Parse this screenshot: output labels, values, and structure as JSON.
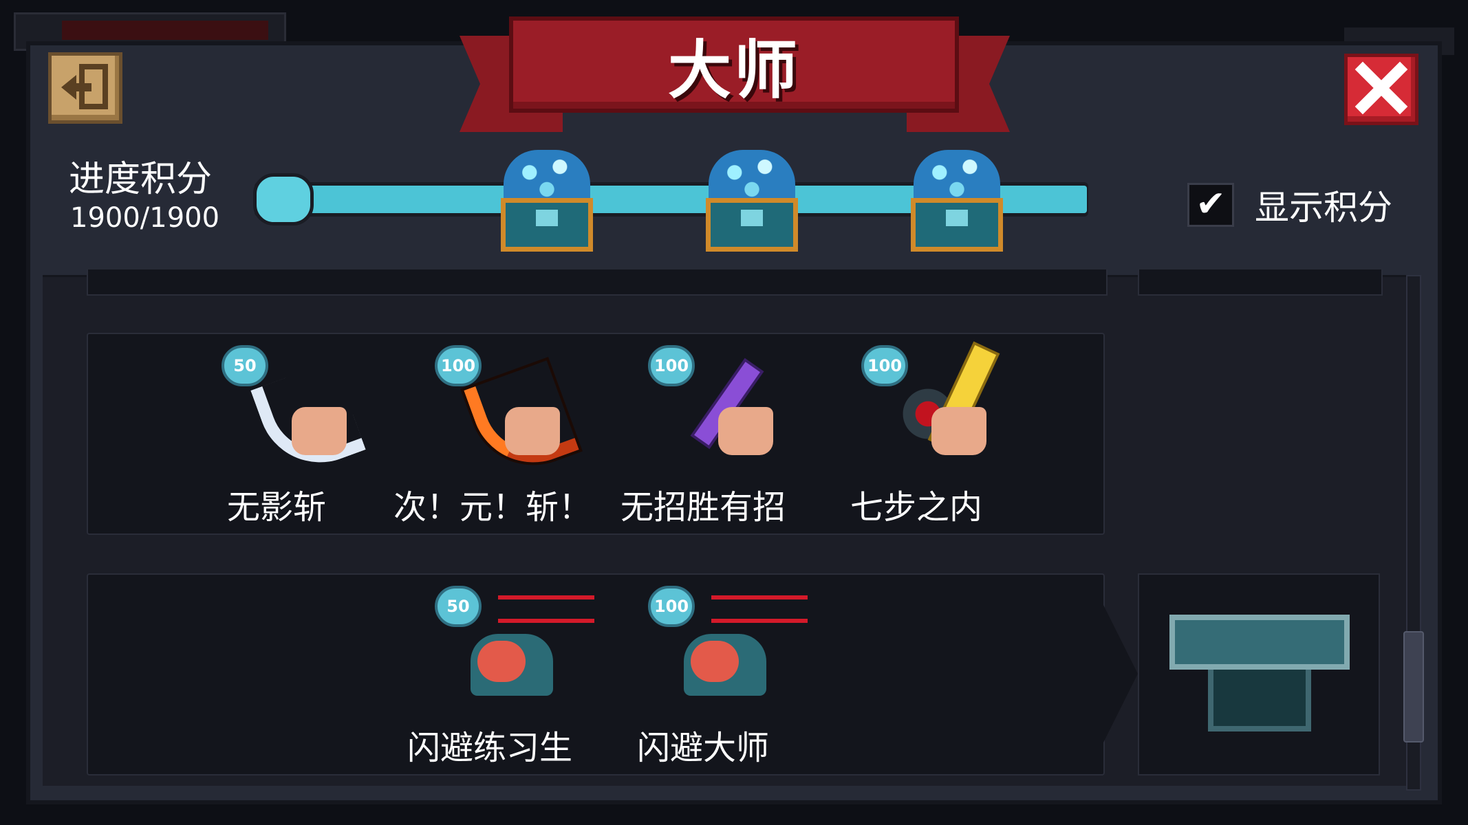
{
  "header": {
    "title": "大师",
    "back_icon": "exit-door-icon",
    "close_icon": "close-x-icon"
  },
  "progress": {
    "label": "进度积分",
    "value_text": "1900/1900",
    "current": 1900,
    "max": 1900,
    "fill_fraction": 1.0,
    "milestones": [
      {
        "icon": "gem-chest-icon"
      },
      {
        "icon": "gem-chest-icon"
      },
      {
        "icon": "gem-chest-icon"
      }
    ]
  },
  "toggle": {
    "label": "显示积分",
    "checked": true,
    "check_glyph": "✔"
  },
  "sections": [
    {
      "items": [
        {
          "name": "无影斩",
          "points": "50",
          "icon": "white-slash-hand-icon"
        },
        {
          "name": "次！元！斩！",
          "points": "100",
          "icon": "orange-slash-hand-icon"
        },
        {
          "name": "无招胜有招",
          "points": "100",
          "icon": "purple-sword-hand-icon"
        },
        {
          "name": "七步之内",
          "points": "100",
          "icon": "gold-sword-blood-icon"
        }
      ]
    },
    {
      "items": [
        {
          "name": "闪避练习生",
          "points": "50",
          "icon": "dodge-dash-icon"
        },
        {
          "name": "闪避大师",
          "points": "100",
          "icon": "dodge-dash-master-icon"
        }
      ],
      "reward_icon": "empty-chest-icon"
    }
  ],
  "colors": {
    "banner": "#9a1d27",
    "progress_fill": "#4cc4d6",
    "close_button": "#d62b36",
    "back_button": "#c8a26a",
    "badge": "#5cc3d6"
  }
}
